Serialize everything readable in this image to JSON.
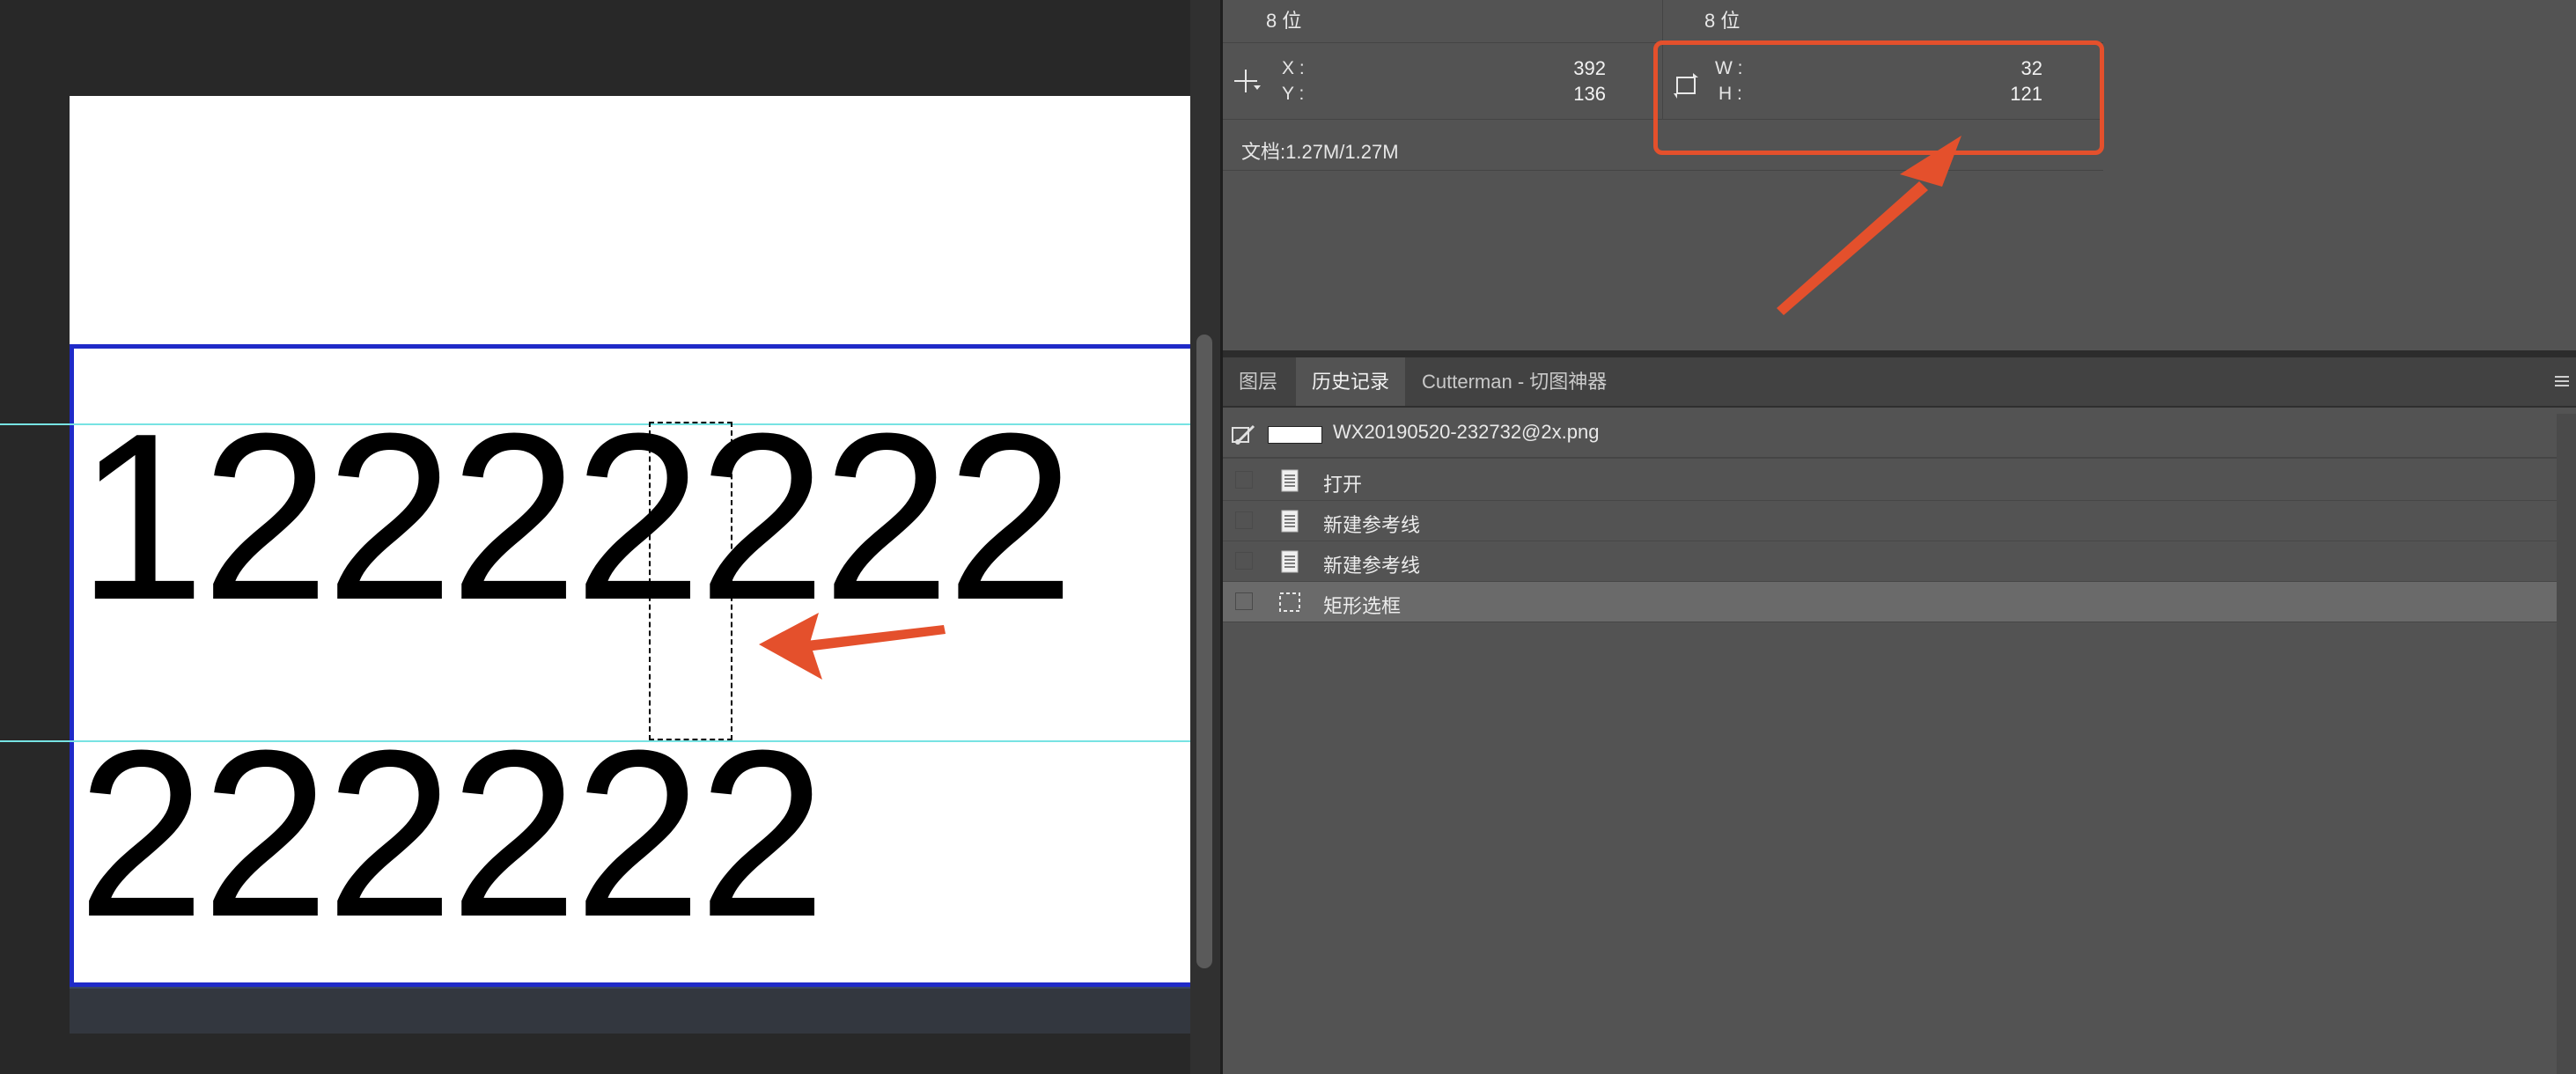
{
  "canvas": {
    "row1_digits": "12222222",
    "row2_digits": "222222"
  },
  "info": {
    "bit_left": "8 位",
    "bit_right": "8 位",
    "x_label": "X :",
    "x_value": "392",
    "y_label": "Y :",
    "y_value": "136",
    "w_label": "W :",
    "w_value": "32",
    "h_label": "H :",
    "h_value": "121",
    "doc_size": "文档:1.27M/1.27M"
  },
  "tabs": [
    {
      "label": "图层"
    },
    {
      "label": "历史记录",
      "active": true
    },
    {
      "label": "Cutterman - 切图神器"
    }
  ],
  "history": {
    "snapshot_name": "WX20190520-232732@2x.png",
    "steps": [
      {
        "label": "打开",
        "icon": "document-icon"
      },
      {
        "label": "新建参考线",
        "icon": "document-icon"
      },
      {
        "label": "新建参考线",
        "icon": "document-icon"
      },
      {
        "label": "矩形选框",
        "icon": "marquee-icon",
        "selected": true
      }
    ]
  },
  "colors": {
    "annotation": "#e4502c",
    "artboard_border": "#1f2ac8",
    "guide": "#77e3e3",
    "panel_bg": "#535353"
  }
}
